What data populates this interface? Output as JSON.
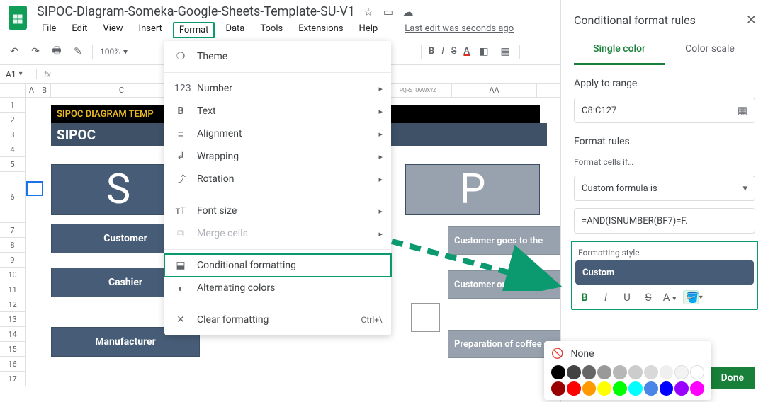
{
  "doc": {
    "title": "SIPOC-Diagram-Someka-Google-Sheets-Template-SU-V1",
    "last_edit": "Last edit was seconds ago"
  },
  "menus": {
    "file": "File",
    "edit": "Edit",
    "view": "View",
    "insert": "Insert",
    "format": "Format",
    "data": "Data",
    "tools": "Tools",
    "extensions": "Extensions",
    "help": "Help"
  },
  "toolbar": {
    "zoom": "100%",
    "bold": "B",
    "italic": "I",
    "strike": "S",
    "textcolor": "A"
  },
  "namebox": "A1",
  "fx": "fx",
  "colhdr": {
    "A": "A",
    "B": "B",
    "C": "C",
    "tiny": "PQRSTUVWXYZ",
    "AA": "AA"
  },
  "rows": [
    "1",
    "2",
    "3",
    "4",
    "5",
    "6",
    "7",
    "8",
    "9",
    "10",
    "11",
    "12",
    "13",
    "14",
    "15",
    "16",
    "17"
  ],
  "sheet": {
    "banner": "SIPOC DIAGRAM TEMP",
    "header": "SIPOC",
    "big_s": "S",
    "big_p": "P",
    "customer": "Customer",
    "cashier": "Cashier",
    "manufacturer": "Manufacturer",
    "p1": "Customer goes to the",
    "p2": "Customer orders the",
    "p3": "Preparation of coffee"
  },
  "format_menu": {
    "theme": "Theme",
    "number": "Number",
    "text": "Text",
    "alignment": "Alignment",
    "wrapping": "Wrapping",
    "rotation": "Rotation",
    "font_size": "Font size",
    "merge_cells": "Merge cells",
    "conditional_formatting": "Conditional formatting",
    "alternating_colors": "Alternating colors",
    "clear_formatting": "Clear formatting",
    "clear_shortcut": "Ctrl+\\"
  },
  "panel": {
    "title": "Conditional format rules",
    "tab_single": "Single color",
    "tab_scale": "Color scale",
    "apply_label": "Apply to range",
    "range": "C8:C127",
    "rules_label": "Format rules",
    "cells_if": "Format cells if…",
    "rule_type": "Custom formula is",
    "formula": "=AND(ISNUMBER(BF7)=F.",
    "style_label": "Formatting style",
    "style_name": "Custom",
    "b": "B",
    "i": "I",
    "u": "U",
    "s": "S",
    "a": "A",
    "none": "None",
    "done": "Done"
  },
  "colors": {
    "greys": [
      "#000000",
      "#434343",
      "#666666",
      "#999999",
      "#b7b7b7",
      "#cccccc",
      "#d9d9d9",
      "#efefef",
      "#f3f3f3",
      "#ffffff"
    ],
    "brights": [
      "#980000",
      "#ff0000",
      "#ff9900",
      "#ffff00",
      "#00ff00",
      "#00ffff",
      "#4a86e8",
      "#0000ff",
      "#9900ff",
      "#ff00ff"
    ]
  }
}
